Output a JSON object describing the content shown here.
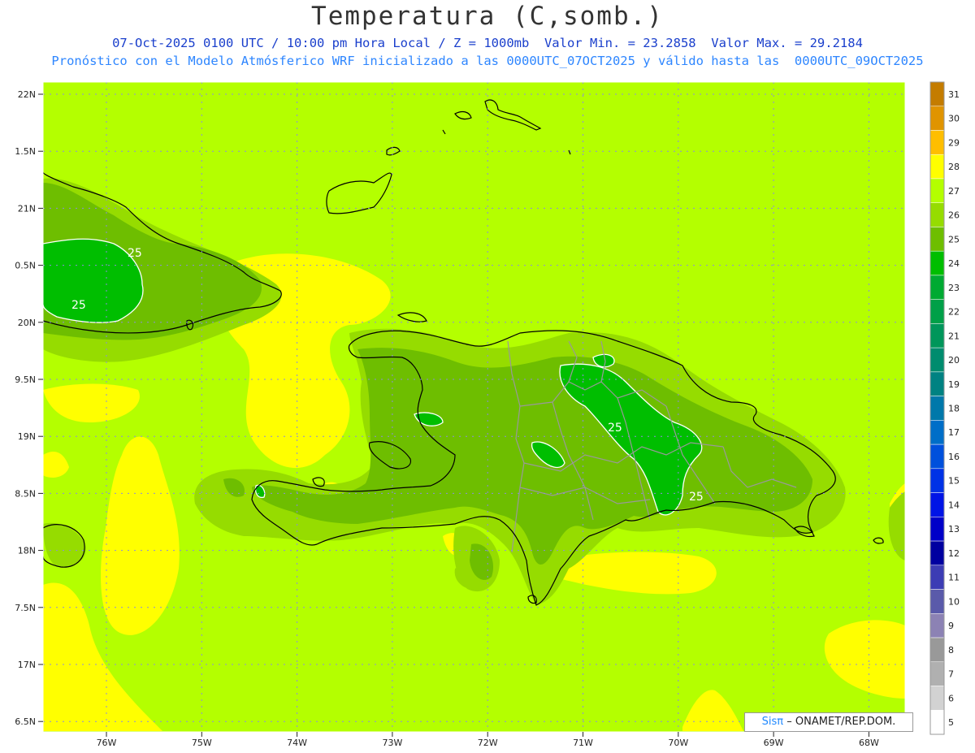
{
  "title": "Temperatura (C,somb.)",
  "subtitle_line1": "07-Oct-2025 0100 UTC / 10:00 pm Hora Local / Z = 1000mb  Valor Min. = 23.2858  Valor Max. = 29.2184",
  "subtitle_line2": "Pronóstico con el Modelo Atmósferico WRF inicializado a las 0000UTC_07OCT2025 y válido hasta las  0000UTC_09OCT2025",
  "credit": {
    "prefix": "Sisπ",
    "rest": "– ONAMET/REP.DOM."
  },
  "lat_labels": [
    "22N",
    "1.5N",
    "21N",
    "0.5N",
    "20N",
    "9.5N",
    "19N",
    "8.5N",
    "18N",
    "7.5N",
    "17N",
    "6.5N"
  ],
  "lon_labels": [
    "76W",
    "75W",
    "74W",
    "73W",
    "72W",
    "71W",
    "70W",
    "69W",
    "68W"
  ],
  "contour_labels": [
    "25",
    "25",
    "25",
    "25"
  ],
  "colorbar": {
    "labels": [
      "31",
      "30",
      "29",
      "28",
      "27",
      "26",
      "25",
      "24",
      "23",
      "22",
      "21",
      "20",
      "19",
      "18",
      "17",
      "16",
      "15",
      "14",
      "13",
      "12",
      "11",
      "10",
      "9",
      "8",
      "7",
      "6",
      "5"
    ],
    "colors": [
      "#c47c00",
      "#e09400",
      "#ffbe00",
      "#ffff00",
      "#b4ff00",
      "#96dc00",
      "#6ebe00",
      "#00be00",
      "#00aa32",
      "#00a048",
      "#00965a",
      "#008c6e",
      "#008282",
      "#0078aa",
      "#006ec8",
      "#0050dc",
      "#0032e6",
      "#0014e6",
      "#0000c8",
      "#0000a0",
      "#3c3cb4",
      "#5a5aaa",
      "#8c82b4",
      "#999999",
      "#b0b0b0",
      "#d2d2d2",
      "#ffffff"
    ]
  },
  "colors": {
    "base": "#b4ff00",
    "warm": "#ffff00",
    "cool1": "#96dc00",
    "cool2": "#6ebe00",
    "cool3": "#00be00",
    "coast": "#000000",
    "border": "#999999",
    "grid": "#8c8cdc"
  }
}
